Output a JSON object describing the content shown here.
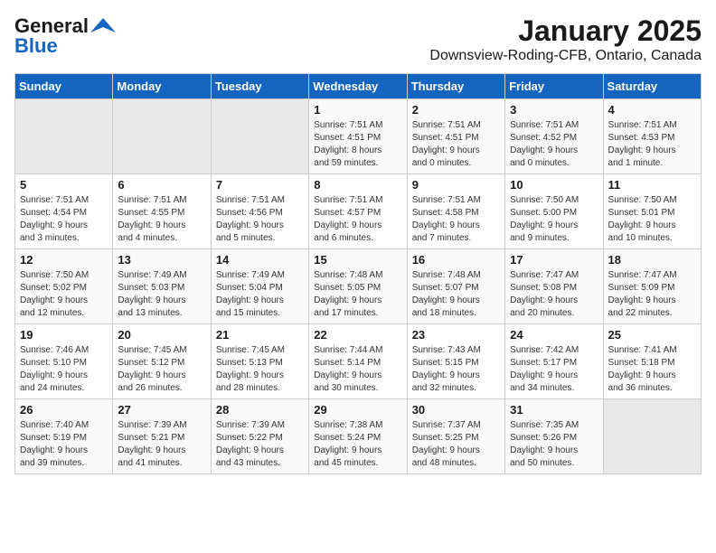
{
  "header": {
    "logo_line1": "General",
    "logo_line2": "Blue",
    "title": "January 2025",
    "subtitle": "Downsview-Roding-CFB, Ontario, Canada"
  },
  "weekdays": [
    "Sunday",
    "Monday",
    "Tuesday",
    "Wednesday",
    "Thursday",
    "Friday",
    "Saturday"
  ],
  "weeks": [
    [
      {
        "day": "",
        "info": ""
      },
      {
        "day": "",
        "info": ""
      },
      {
        "day": "",
        "info": ""
      },
      {
        "day": "1",
        "info": "Sunrise: 7:51 AM\nSunset: 4:51 PM\nDaylight: 8 hours\nand 59 minutes."
      },
      {
        "day": "2",
        "info": "Sunrise: 7:51 AM\nSunset: 4:51 PM\nDaylight: 9 hours\nand 0 minutes."
      },
      {
        "day": "3",
        "info": "Sunrise: 7:51 AM\nSunset: 4:52 PM\nDaylight: 9 hours\nand 0 minutes."
      },
      {
        "day": "4",
        "info": "Sunrise: 7:51 AM\nSunset: 4:53 PM\nDaylight: 9 hours\nand 1 minute."
      }
    ],
    [
      {
        "day": "5",
        "info": "Sunrise: 7:51 AM\nSunset: 4:54 PM\nDaylight: 9 hours\nand 3 minutes."
      },
      {
        "day": "6",
        "info": "Sunrise: 7:51 AM\nSunset: 4:55 PM\nDaylight: 9 hours\nand 4 minutes."
      },
      {
        "day": "7",
        "info": "Sunrise: 7:51 AM\nSunset: 4:56 PM\nDaylight: 9 hours\nand 5 minutes."
      },
      {
        "day": "8",
        "info": "Sunrise: 7:51 AM\nSunset: 4:57 PM\nDaylight: 9 hours\nand 6 minutes."
      },
      {
        "day": "9",
        "info": "Sunrise: 7:51 AM\nSunset: 4:58 PM\nDaylight: 9 hours\nand 7 minutes."
      },
      {
        "day": "10",
        "info": "Sunrise: 7:50 AM\nSunset: 5:00 PM\nDaylight: 9 hours\nand 9 minutes."
      },
      {
        "day": "11",
        "info": "Sunrise: 7:50 AM\nSunset: 5:01 PM\nDaylight: 9 hours\nand 10 minutes."
      }
    ],
    [
      {
        "day": "12",
        "info": "Sunrise: 7:50 AM\nSunset: 5:02 PM\nDaylight: 9 hours\nand 12 minutes."
      },
      {
        "day": "13",
        "info": "Sunrise: 7:49 AM\nSunset: 5:03 PM\nDaylight: 9 hours\nand 13 minutes."
      },
      {
        "day": "14",
        "info": "Sunrise: 7:49 AM\nSunset: 5:04 PM\nDaylight: 9 hours\nand 15 minutes."
      },
      {
        "day": "15",
        "info": "Sunrise: 7:48 AM\nSunset: 5:05 PM\nDaylight: 9 hours\nand 17 minutes."
      },
      {
        "day": "16",
        "info": "Sunrise: 7:48 AM\nSunset: 5:07 PM\nDaylight: 9 hours\nand 18 minutes."
      },
      {
        "day": "17",
        "info": "Sunrise: 7:47 AM\nSunset: 5:08 PM\nDaylight: 9 hours\nand 20 minutes."
      },
      {
        "day": "18",
        "info": "Sunrise: 7:47 AM\nSunset: 5:09 PM\nDaylight: 9 hours\nand 22 minutes."
      }
    ],
    [
      {
        "day": "19",
        "info": "Sunrise: 7:46 AM\nSunset: 5:10 PM\nDaylight: 9 hours\nand 24 minutes."
      },
      {
        "day": "20",
        "info": "Sunrise: 7:45 AM\nSunset: 5:12 PM\nDaylight: 9 hours\nand 26 minutes."
      },
      {
        "day": "21",
        "info": "Sunrise: 7:45 AM\nSunset: 5:13 PM\nDaylight: 9 hours\nand 28 minutes."
      },
      {
        "day": "22",
        "info": "Sunrise: 7:44 AM\nSunset: 5:14 PM\nDaylight: 9 hours\nand 30 minutes."
      },
      {
        "day": "23",
        "info": "Sunrise: 7:43 AM\nSunset: 5:15 PM\nDaylight: 9 hours\nand 32 minutes."
      },
      {
        "day": "24",
        "info": "Sunrise: 7:42 AM\nSunset: 5:17 PM\nDaylight: 9 hours\nand 34 minutes."
      },
      {
        "day": "25",
        "info": "Sunrise: 7:41 AM\nSunset: 5:18 PM\nDaylight: 9 hours\nand 36 minutes."
      }
    ],
    [
      {
        "day": "26",
        "info": "Sunrise: 7:40 AM\nSunset: 5:19 PM\nDaylight: 9 hours\nand 39 minutes."
      },
      {
        "day": "27",
        "info": "Sunrise: 7:39 AM\nSunset: 5:21 PM\nDaylight: 9 hours\nand 41 minutes."
      },
      {
        "day": "28",
        "info": "Sunrise: 7:39 AM\nSunset: 5:22 PM\nDaylight: 9 hours\nand 43 minutes."
      },
      {
        "day": "29",
        "info": "Sunrise: 7:38 AM\nSunset: 5:24 PM\nDaylight: 9 hours\nand 45 minutes."
      },
      {
        "day": "30",
        "info": "Sunrise: 7:37 AM\nSunset: 5:25 PM\nDaylight: 9 hours\nand 48 minutes."
      },
      {
        "day": "31",
        "info": "Sunrise: 7:35 AM\nSunset: 5:26 PM\nDaylight: 9 hours\nand 50 minutes."
      },
      {
        "day": "",
        "info": ""
      }
    ]
  ]
}
